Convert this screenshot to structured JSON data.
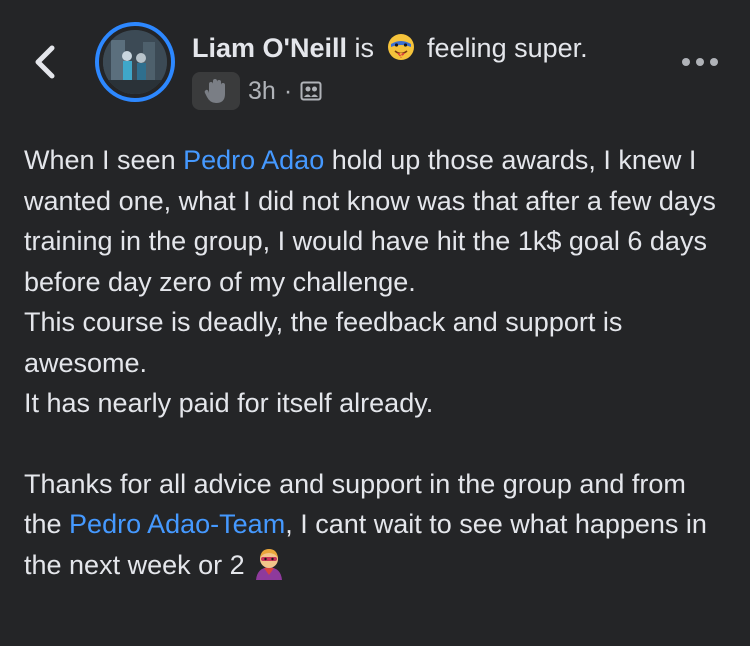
{
  "header": {
    "back_icon": "chevron-left-icon",
    "author_name": "Liam O'Neill",
    "activity_prefix": "is",
    "feeling_text": "feeling super.",
    "feeling_icon": "superhero-face-icon",
    "group_icon": "waving-hand-icon",
    "timestamp": "3h",
    "separator": "·",
    "audience_icon": "group-audience-icon",
    "more_icon": "more-dots-icon"
  },
  "post": {
    "p1_a": "When I seen ",
    "mention_1": "Pedro Adao",
    "p1_b": " hold up those awards, I knew I wanted one, what I did not know was that after a few days training in the group, I would have hit the 1k$ goal 6 days before day zero of my challenge.",
    "p2": "This course is deadly, the feedback and support is awesome.",
    "p3": "It has nearly paid for itself already.",
    "p4_a": "Thanks for all advice and support in the group and from the ",
    "mention_2": "Pedro Adao-Team",
    "p4_b": ", I cant wait to see what happens in the next week or 2",
    "end_icon": "superhero-emoji-icon"
  },
  "colors": {
    "background": "#242527",
    "text": "#e4e6eb",
    "secondary_text": "#b0b3b8",
    "link": "#4599ff",
    "avatar_ring": "#2d88ff"
  }
}
